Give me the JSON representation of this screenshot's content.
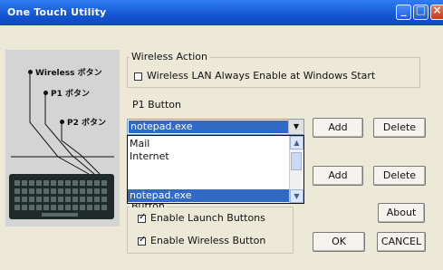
{
  "window": {
    "title": "One Touch Utility"
  },
  "illustration": {
    "labels": [
      "Wireless ボタン",
      "P1 ボタン",
      "P2 ボタン"
    ]
  },
  "wireless_action": {
    "legend": "Wireless Action",
    "checkbox_label": "Wireless LAN Always Enable at Windows Start",
    "checked": false
  },
  "p1": {
    "label": "P1  Button",
    "selected_value": "notepad.exe",
    "add_label": "Add",
    "delete_label": "Delete",
    "dropdown_options": [
      "Mail",
      "Internet",
      "notepad.exe"
    ],
    "dropdown_selected": "notepad.exe"
  },
  "p2": {
    "add_label": "Add",
    "delete_label": "Delete"
  },
  "buttons_group": {
    "legend": "Button",
    "enable_launch_label": "Enable Launch Buttons",
    "enable_wireless_label": "Enable Wireless Button",
    "enable_launch_checked": true,
    "enable_wireless_checked": true
  },
  "footer": {
    "about_label": "About",
    "ok_label": "OK",
    "cancel_label": "CANCEL"
  },
  "colors": {
    "titlebar": "#1658d4",
    "selection": "#316ac5",
    "window_bg": "#ece9d8"
  }
}
